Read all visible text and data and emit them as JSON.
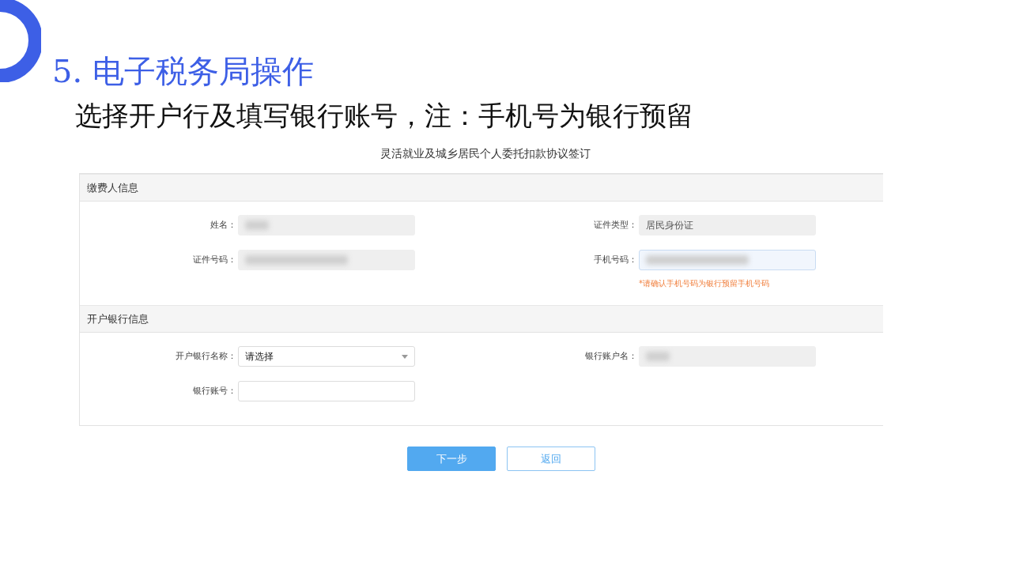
{
  "slide": {
    "title": "5. 电子税务局操作",
    "subtitle": "选择开户行及填写银行账号，注：手机号为银行预留"
  },
  "form": {
    "title": "灵活就业及城乡居民个人委托扣款协议签订",
    "sections": [
      {
        "heading": "缴费人信息",
        "rows": [
          [
            {
              "label": "姓名：",
              "kind": "readonly",
              "masked": true,
              "focused": false
            },
            {
              "label": "证件类型：",
              "kind": "readonly",
              "value": "居民身份证",
              "focused": false
            }
          ],
          [
            {
              "label": "证件号码：",
              "kind": "readonly",
              "masked": true,
              "focused": false
            },
            {
              "label": "手机号码：",
              "kind": "input",
              "masked": true,
              "focused": true,
              "hint": "*请确认手机号码为银行预留手机号码"
            }
          ]
        ]
      },
      {
        "heading": "开户银行信息",
        "rows": [
          [
            {
              "label": "开户银行名称：",
              "kind": "select",
              "value": "请选择",
              "focused": false
            },
            {
              "label": "银行账户名：",
              "kind": "readonly",
              "masked": true,
              "focused": false
            }
          ],
          [
            {
              "label": "银行账号：",
              "kind": "input",
              "focused": false
            }
          ]
        ]
      }
    ],
    "buttons": [
      {
        "label": "下一步",
        "kind": "primary"
      },
      {
        "label": "返回",
        "kind": "secondary"
      }
    ]
  }
}
